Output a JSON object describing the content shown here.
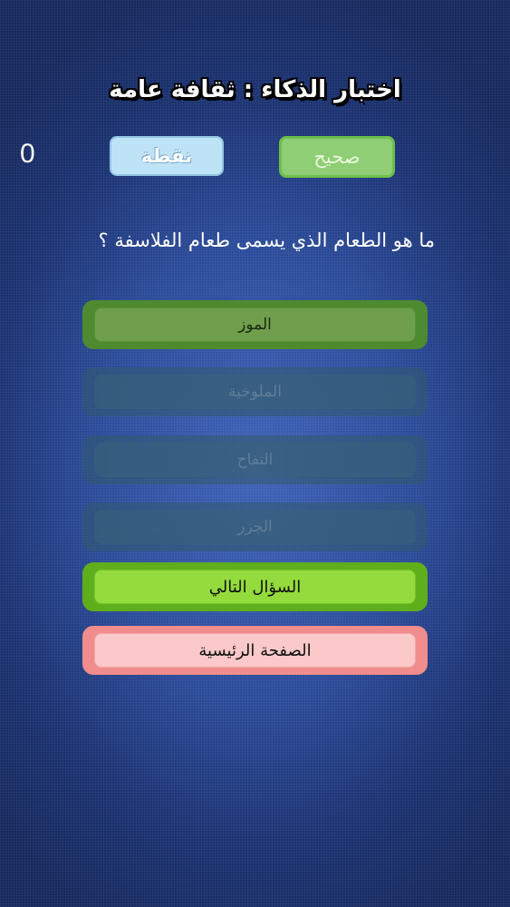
{
  "header": {
    "title": "اختبار الذكاء : ثقافة عامة"
  },
  "score": {
    "value": "0",
    "points_label": "نقطة",
    "result_label": "صحيح"
  },
  "question": {
    "text": "ما هو الطعام الذي يسمى طعام الفلاسفة ؟"
  },
  "answers": [
    {
      "label": "الموز",
      "state": "correct"
    },
    {
      "label": "الملوخية",
      "state": "faded"
    },
    {
      "label": "التفاح",
      "state": "faded"
    },
    {
      "label": "الجزر",
      "state": "faded"
    }
  ],
  "actions": {
    "next_label": "السؤال التالي",
    "home_label": "الصفحة الرئيسية"
  },
  "colors": {
    "correct_green": "#4d8a30",
    "next_green": "#94dc3d",
    "home_pink": "#fbc9c9",
    "background_blue": "#2c4c9a"
  }
}
